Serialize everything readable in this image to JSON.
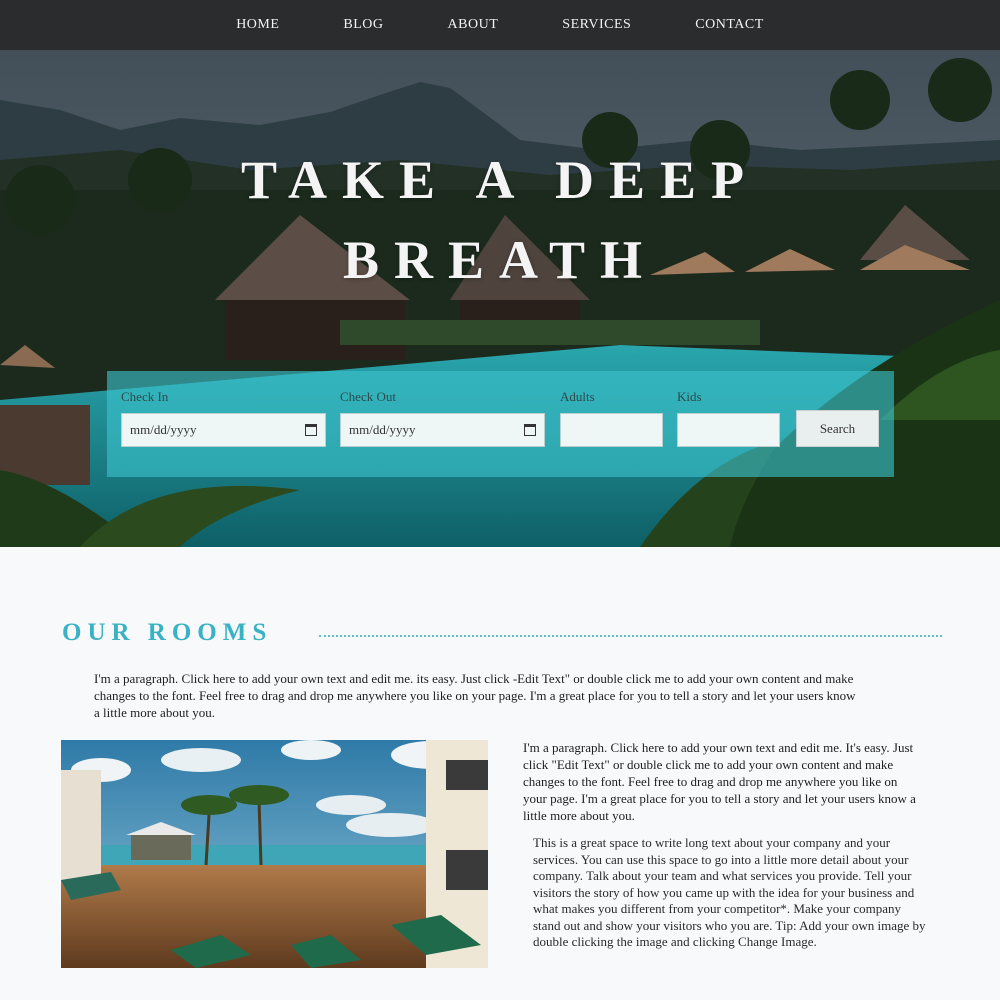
{
  "nav": {
    "items": [
      "HOME",
      "BLOG",
      "ABOUT",
      "SERVICES",
      "CONTACT"
    ]
  },
  "hero": {
    "title_line1": "TAKE A DEEP",
    "title_line2": "BREATH"
  },
  "booking": {
    "check_in_label": "Check In",
    "check_in_value": "mm/dd/yyyy",
    "check_out_label": "Check Out",
    "check_out_value": "mm/dd/yyyy",
    "adults_label": "Adults",
    "kids_label": "Kids",
    "search_label": "Search"
  },
  "rooms": {
    "title": "OUR ROOMS",
    "paragraph1": "I'm a paragraph. Click here to add your own text and edit me. its easy. Just click -Edit Text\" or double click me to add your own content and make changes to the font. Feel free to drag and drop me anywhere you like on your page. I'm a great place for you to tell a story and let your users know a little more about you.",
    "paragraph2": "I'm a paragraph. Click here to add your own text and edit me. It's easy. Just click \"Edit Text\" or double click me to add your own content and make changes to the font. Feel free to drag and drop me anywhere you like on your page. I'm a great place for you to tell a story and let your users know a little more about you.",
    "paragraph3": "This is a great space to write long text about your company and your services. You can use this space to go into a little more detail about your company. Talk about your team and what services you provide. Tell your visitors the story of how you came up with the idea for your business and what makes you different from your competitor*. Make your company stand out and show your visitors who you are. Tip: Add your own image by double clicking the image and clicking Change Image."
  },
  "colors": {
    "accent": "#3ab2c4",
    "nav_bg": "#282828",
    "booking_bg": "#3cc3cd"
  },
  "icons": {
    "date_picker": "calendar-icon"
  }
}
